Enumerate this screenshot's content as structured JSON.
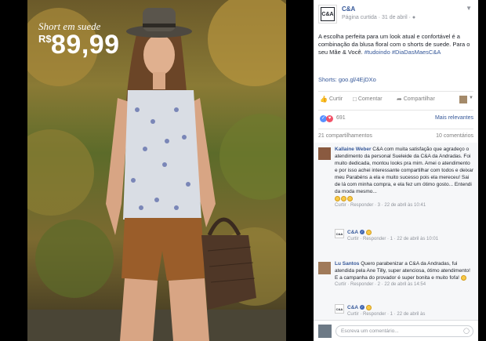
{
  "photo": {
    "promo_label": "Short em suede",
    "currency": "R$",
    "price": "89,99"
  },
  "post": {
    "page_name": "C&A",
    "page_logo": "C&A",
    "meta": "Página curtida · 31 de abril · ",
    "text_plain": "A escolha perfeita para um look atual e confortável é a combinação da blusa floral com o shorts de suede. Para o seu Mãe & Você.",
    "hashtags": "#tudoindo #DiaDasMaesC&A",
    "short_link": "Shorts: goo.gl/4EjDXo",
    "actions": {
      "like": "Curtir",
      "comment": "Comentar",
      "share": "Compartilhar"
    },
    "reaction_count": "691",
    "filter": "Mais relevantes",
    "shares": "21 compartilhamentos",
    "comment_count": "10 comentários"
  },
  "comments": [
    {
      "author": "Kallaine Weber",
      "text": "C&A com muita satisfação que agradeço o atendimento da personal Sueleide da C&A da Andradas. Foi muito dedicada, montou looks pra mim. Amei o atendimento e por isso achei interessante compartilhar com todos e deixar meu Parabéns a ela e muito sucesso pois ela mereceu! Sai de lá com minha compra, e ela fez um ótimo gosto... Entendi da moda mesmo...",
      "meta": "Curtir · Responder · 3 · 22 de abril às 10:41",
      "reply": {
        "author": "C&A",
        "meta": "Curtir · Responder · 1 · 22 de abril às 10:01"
      }
    },
    {
      "author": "Lu Santos",
      "text": "Quero parabenizar a C&A da Andradas, fui atendida pela Ane Tilly, super atenciosa, ótimo atendimento! E a campanha do provador é super bonita e muito fofa!",
      "meta": "Curtir · Responder · 2 · 22 de abril às 14:54",
      "reply": {
        "author": "C&A",
        "meta": "Curtir · Responder · 1 · 22 de abril às"
      }
    }
  ],
  "composer": {
    "placeholder": "Escreva um comentário..."
  },
  "colors": {
    "link": "#365899",
    "like_blue": "#5890ff",
    "love_red": "#f25268"
  }
}
